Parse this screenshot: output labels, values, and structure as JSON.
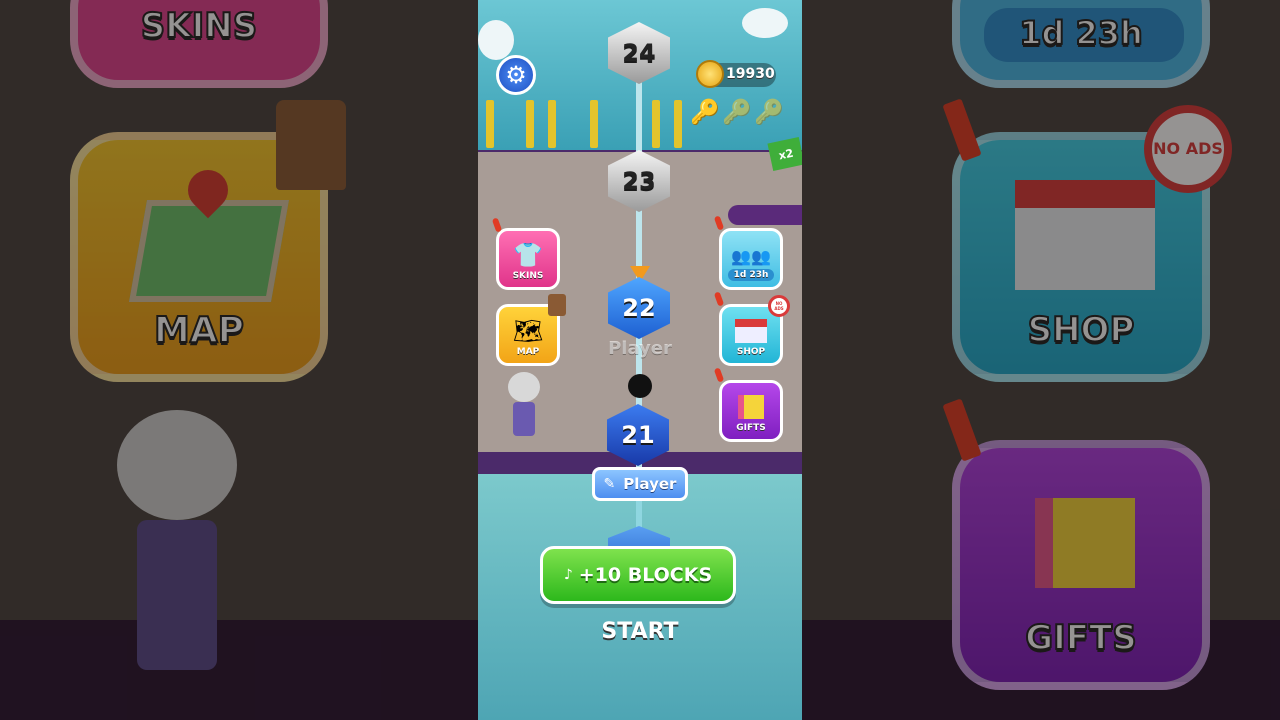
{
  "background": {
    "left": {
      "skins_label": "SKINS",
      "map_label": "MAP"
    },
    "right": {
      "timer": "1d 23h",
      "shop_label": "SHOP",
      "gifts_label": "GIFTS",
      "no_ads": "NO ADS"
    }
  },
  "hud": {
    "coins": "19930",
    "multiplier": "x2"
  },
  "levels": [
    {
      "number": "24",
      "state": "locked"
    },
    {
      "number": "23",
      "state": "locked"
    },
    {
      "number": "22",
      "state": "current"
    },
    {
      "number": "21",
      "state": "completed"
    }
  ],
  "player": {
    "ghost_label": "Player",
    "name_tag": "Player"
  },
  "menu_left": [
    {
      "label": "SKINS",
      "icon": "tshirt-icon",
      "color": "#f0459b"
    },
    {
      "label": "MAP",
      "icon": "map-icon",
      "color": "#f5b81f"
    }
  ],
  "menu_right": [
    {
      "label": "1d 23h",
      "icon": "characters-icon",
      "color": "#4fc7e8"
    },
    {
      "label": "SHOP",
      "icon": "store-icon",
      "color": "#2fc6e0",
      "badge": "NO ADS"
    },
    {
      "label": "GIFTS",
      "icon": "gift-icon",
      "color": "#9b2ad6"
    }
  ],
  "actions": {
    "blocks_button": "+10 BLOCKS",
    "start": "START"
  }
}
